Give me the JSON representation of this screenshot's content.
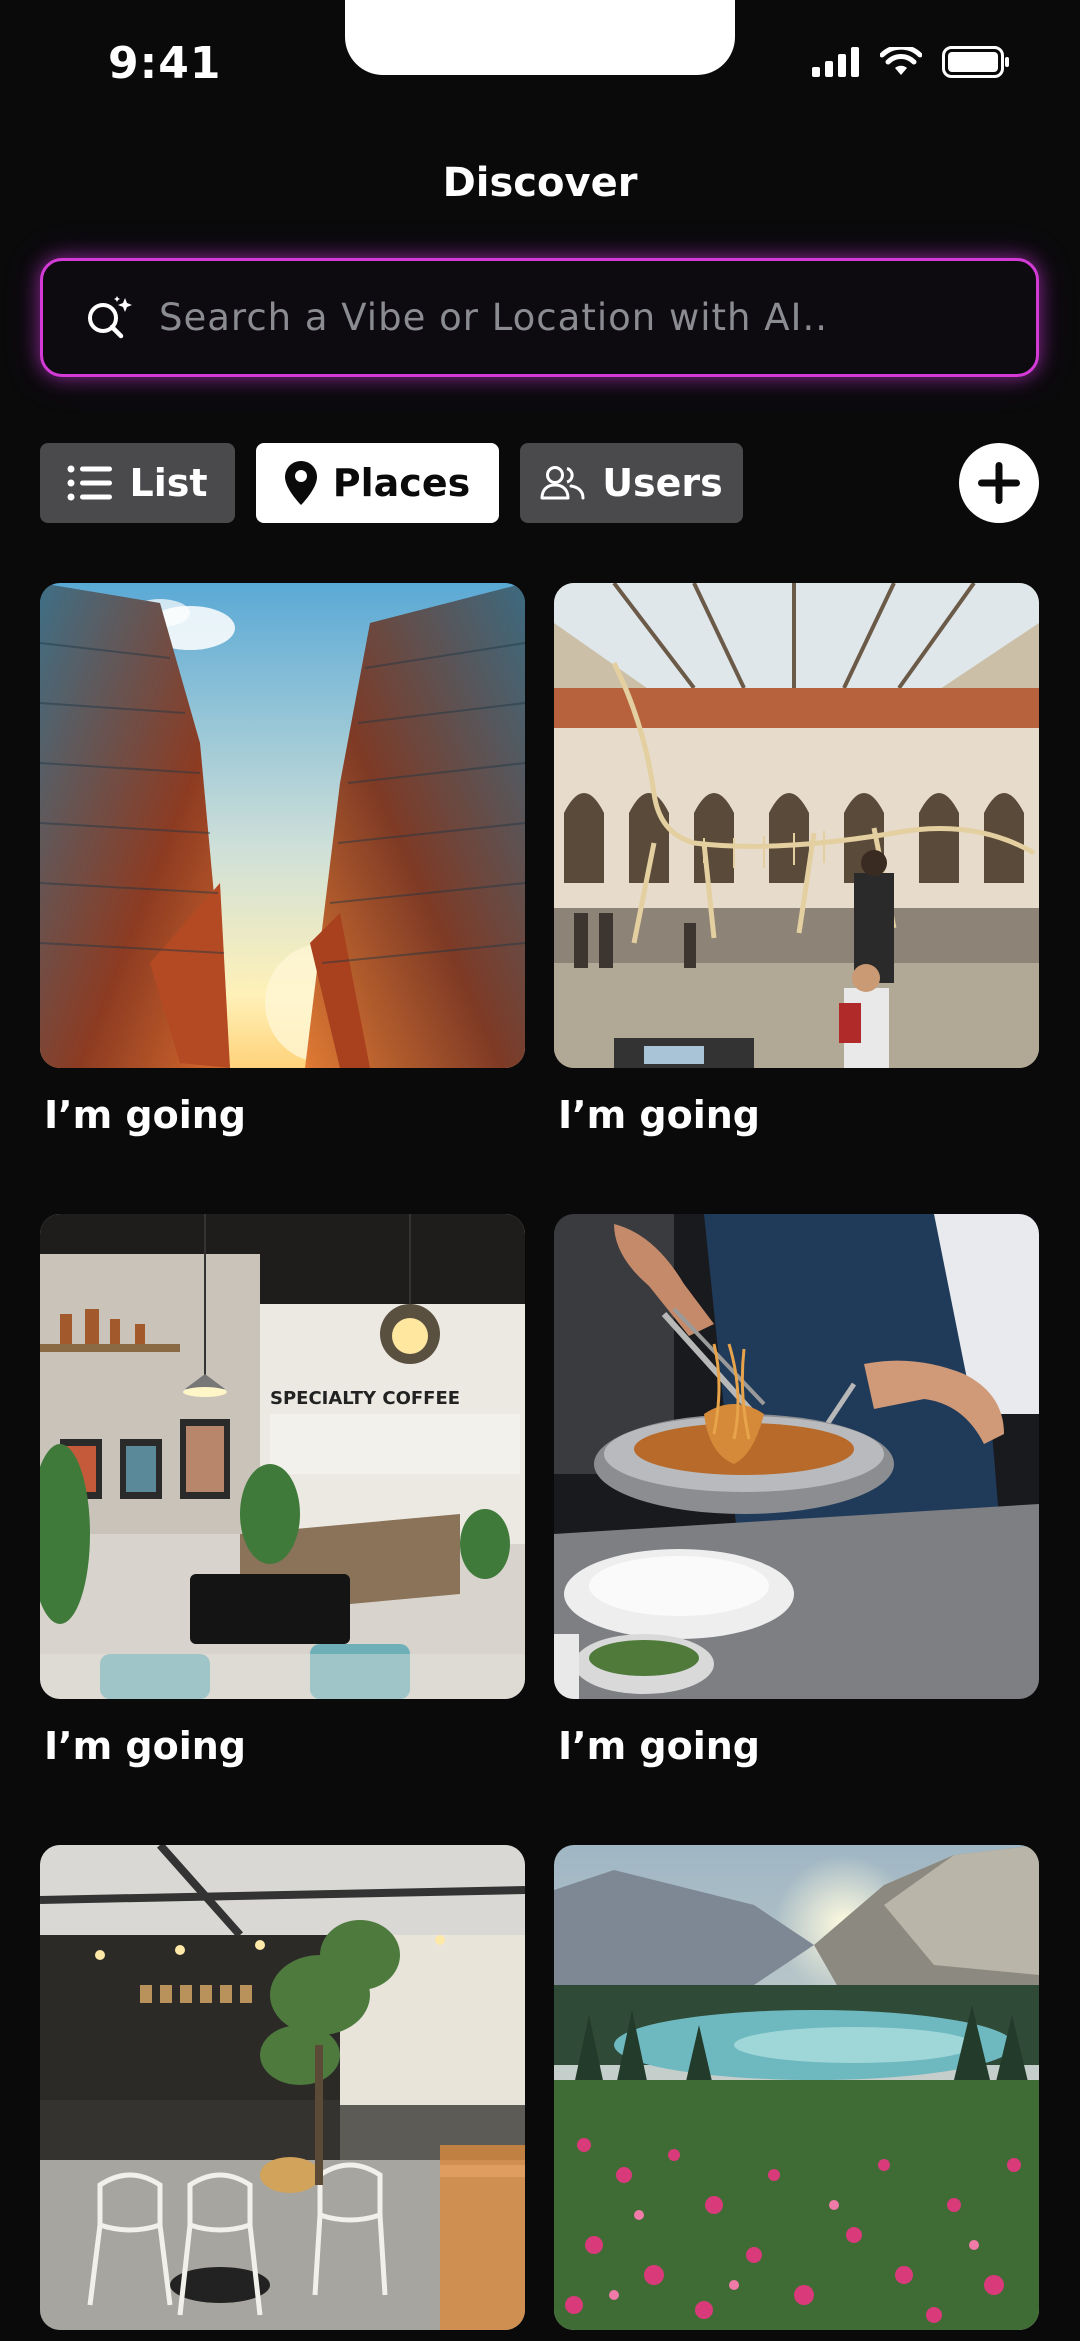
{
  "status_bar": {
    "time": "9:41"
  },
  "header": {
    "title": "Discover"
  },
  "search": {
    "placeholder": "Search a Vibe or Location with AI.."
  },
  "tabs": [
    {
      "label": "List",
      "icon": "list-icon",
      "active": false
    },
    {
      "label": "Places",
      "icon": "map-pin-icon",
      "active": true
    },
    {
      "label": "Users",
      "icon": "users-icon",
      "active": false
    }
  ],
  "add_button": {
    "icon": "plus-icon"
  },
  "places": [
    {
      "label": "I’m going",
      "image": "skyscrapers-photo"
    },
    {
      "label": "I’m going",
      "image": "museum-dinosaur-photo"
    },
    {
      "label": "I’m going",
      "image": "coffee-shop-photo"
    },
    {
      "label": "I’m going",
      "image": "chef-cooking-photo"
    },
    {
      "label": "",
      "image": "cafe-interior-photo"
    },
    {
      "label": "",
      "image": "mountain-lake-photo"
    }
  ]
}
